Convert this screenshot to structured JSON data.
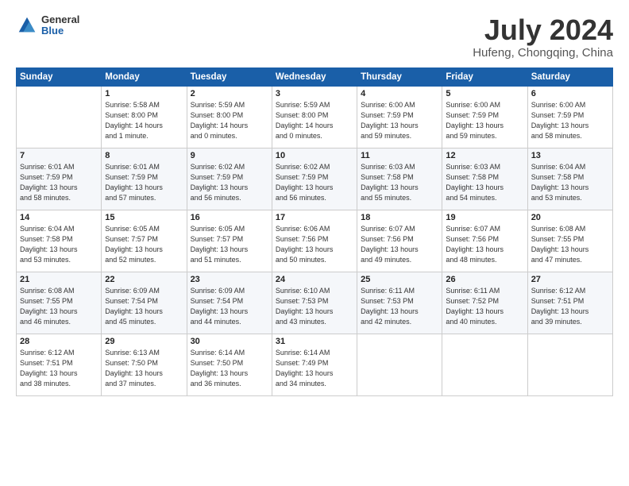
{
  "logo": {
    "general": "General",
    "blue": "Blue"
  },
  "title": "July 2024",
  "subtitle": "Hufeng, Chongqing, China",
  "days": [
    "Sunday",
    "Monday",
    "Tuesday",
    "Wednesday",
    "Thursday",
    "Friday",
    "Saturday"
  ],
  "weeks": [
    [
      {
        "date": "",
        "info": ""
      },
      {
        "date": "1",
        "info": "Sunrise: 5:58 AM\nSunset: 8:00 PM\nDaylight: 14 hours\nand 1 minute."
      },
      {
        "date": "2",
        "info": "Sunrise: 5:59 AM\nSunset: 8:00 PM\nDaylight: 14 hours\nand 0 minutes."
      },
      {
        "date": "3",
        "info": "Sunrise: 5:59 AM\nSunset: 8:00 PM\nDaylight: 14 hours\nand 0 minutes."
      },
      {
        "date": "4",
        "info": "Sunrise: 6:00 AM\nSunset: 7:59 PM\nDaylight: 13 hours\nand 59 minutes."
      },
      {
        "date": "5",
        "info": "Sunrise: 6:00 AM\nSunset: 7:59 PM\nDaylight: 13 hours\nand 59 minutes."
      },
      {
        "date": "6",
        "info": "Sunrise: 6:00 AM\nSunset: 7:59 PM\nDaylight: 13 hours\nand 58 minutes."
      }
    ],
    [
      {
        "date": "7",
        "info": "Sunrise: 6:01 AM\nSunset: 7:59 PM\nDaylight: 13 hours\nand 58 minutes."
      },
      {
        "date": "8",
        "info": "Sunrise: 6:01 AM\nSunset: 7:59 PM\nDaylight: 13 hours\nand 57 minutes."
      },
      {
        "date": "9",
        "info": "Sunrise: 6:02 AM\nSunset: 7:59 PM\nDaylight: 13 hours\nand 56 minutes."
      },
      {
        "date": "10",
        "info": "Sunrise: 6:02 AM\nSunset: 7:59 PM\nDaylight: 13 hours\nand 56 minutes."
      },
      {
        "date": "11",
        "info": "Sunrise: 6:03 AM\nSunset: 7:58 PM\nDaylight: 13 hours\nand 55 minutes."
      },
      {
        "date": "12",
        "info": "Sunrise: 6:03 AM\nSunset: 7:58 PM\nDaylight: 13 hours\nand 54 minutes."
      },
      {
        "date": "13",
        "info": "Sunrise: 6:04 AM\nSunset: 7:58 PM\nDaylight: 13 hours\nand 53 minutes."
      }
    ],
    [
      {
        "date": "14",
        "info": "Sunrise: 6:04 AM\nSunset: 7:58 PM\nDaylight: 13 hours\nand 53 minutes."
      },
      {
        "date": "15",
        "info": "Sunrise: 6:05 AM\nSunset: 7:57 PM\nDaylight: 13 hours\nand 52 minutes."
      },
      {
        "date": "16",
        "info": "Sunrise: 6:05 AM\nSunset: 7:57 PM\nDaylight: 13 hours\nand 51 minutes."
      },
      {
        "date": "17",
        "info": "Sunrise: 6:06 AM\nSunset: 7:56 PM\nDaylight: 13 hours\nand 50 minutes."
      },
      {
        "date": "18",
        "info": "Sunrise: 6:07 AM\nSunset: 7:56 PM\nDaylight: 13 hours\nand 49 minutes."
      },
      {
        "date": "19",
        "info": "Sunrise: 6:07 AM\nSunset: 7:56 PM\nDaylight: 13 hours\nand 48 minutes."
      },
      {
        "date": "20",
        "info": "Sunrise: 6:08 AM\nSunset: 7:55 PM\nDaylight: 13 hours\nand 47 minutes."
      }
    ],
    [
      {
        "date": "21",
        "info": "Sunrise: 6:08 AM\nSunset: 7:55 PM\nDaylight: 13 hours\nand 46 minutes."
      },
      {
        "date": "22",
        "info": "Sunrise: 6:09 AM\nSunset: 7:54 PM\nDaylight: 13 hours\nand 45 minutes."
      },
      {
        "date": "23",
        "info": "Sunrise: 6:09 AM\nSunset: 7:54 PM\nDaylight: 13 hours\nand 44 minutes."
      },
      {
        "date": "24",
        "info": "Sunrise: 6:10 AM\nSunset: 7:53 PM\nDaylight: 13 hours\nand 43 minutes."
      },
      {
        "date": "25",
        "info": "Sunrise: 6:11 AM\nSunset: 7:53 PM\nDaylight: 13 hours\nand 42 minutes."
      },
      {
        "date": "26",
        "info": "Sunrise: 6:11 AM\nSunset: 7:52 PM\nDaylight: 13 hours\nand 40 minutes."
      },
      {
        "date": "27",
        "info": "Sunrise: 6:12 AM\nSunset: 7:51 PM\nDaylight: 13 hours\nand 39 minutes."
      }
    ],
    [
      {
        "date": "28",
        "info": "Sunrise: 6:12 AM\nSunset: 7:51 PM\nDaylight: 13 hours\nand 38 minutes."
      },
      {
        "date": "29",
        "info": "Sunrise: 6:13 AM\nSunset: 7:50 PM\nDaylight: 13 hours\nand 37 minutes."
      },
      {
        "date": "30",
        "info": "Sunrise: 6:14 AM\nSunset: 7:50 PM\nDaylight: 13 hours\nand 36 minutes."
      },
      {
        "date": "31",
        "info": "Sunrise: 6:14 AM\nSunset: 7:49 PM\nDaylight: 13 hours\nand 34 minutes."
      },
      {
        "date": "",
        "info": ""
      },
      {
        "date": "",
        "info": ""
      },
      {
        "date": "",
        "info": ""
      }
    ]
  ]
}
